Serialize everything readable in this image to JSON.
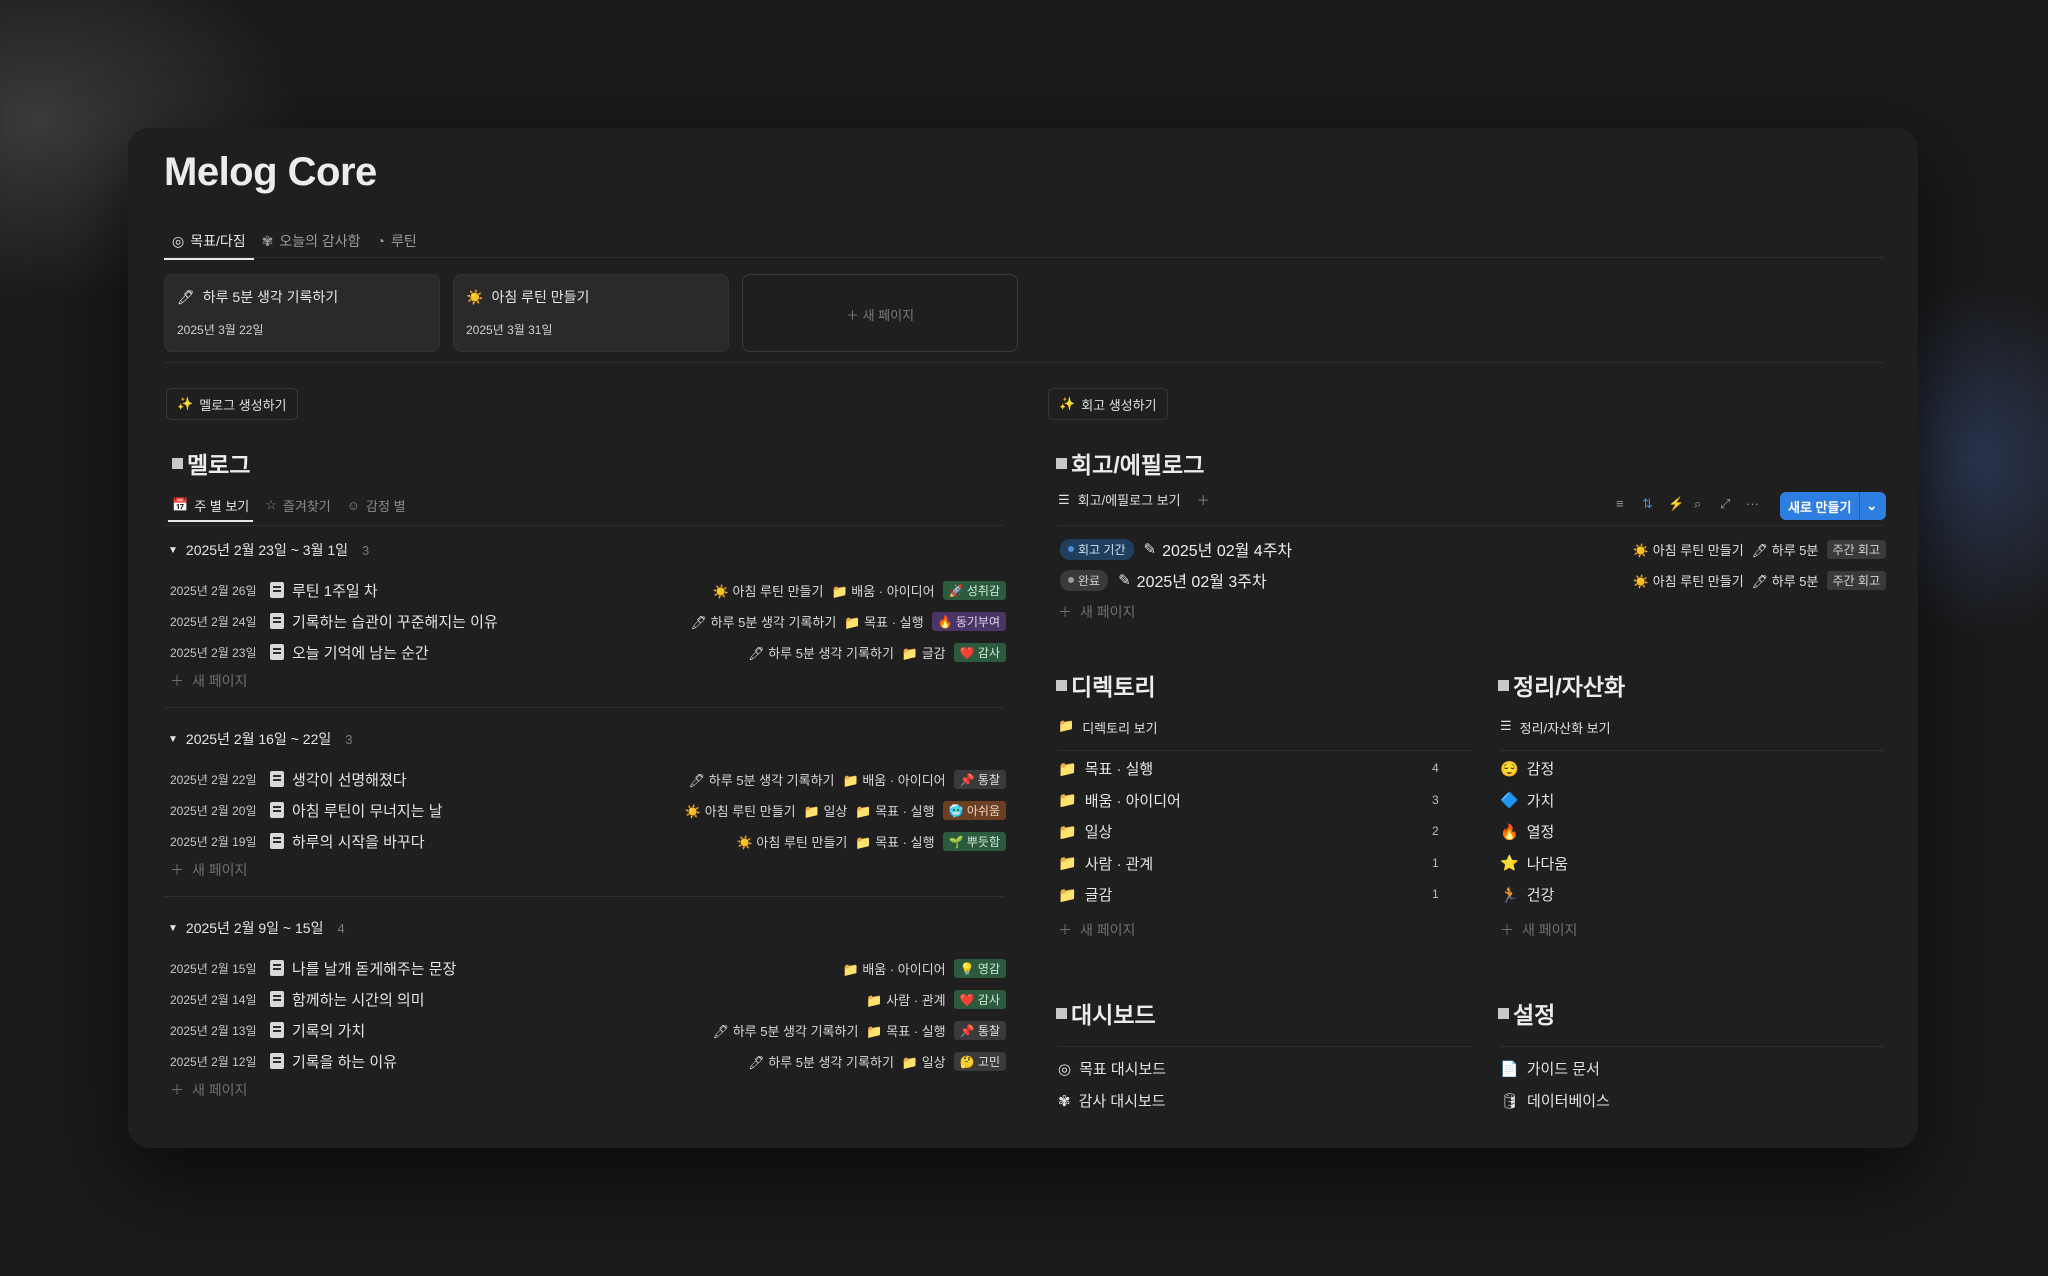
{
  "app": {
    "title": "Melog Core"
  },
  "tabs": [
    {
      "label": "목표/다짐",
      "icon": "target-icon"
    },
    {
      "label": "오늘의 감사함",
      "icon": "flower-icon"
    },
    {
      "label": "루틴",
      "icon": "routine-icon"
    }
  ],
  "goal_cards": [
    {
      "icon": "pencil-icon",
      "title": "하루 5분 생각 기록하기",
      "date": "2025년 3월 22일"
    },
    {
      "icon": "sun-icon",
      "title": "아침 루틴 만들기",
      "date": "2025년 3월 31일"
    }
  ],
  "new_page_label": "새 페이지",
  "melog": {
    "generate_label": "멜로그 생성하기",
    "title": "멜로그",
    "views": [
      "주 별 보기",
      "즐겨찾기",
      "감정 별"
    ],
    "groups": [
      {
        "label": "2025년 2월 23일 ~ 3월 1일",
        "count": "3",
        "rows": [
          {
            "date": "2025년 2월 26일",
            "title": "루틴 1주일 차",
            "goal": "☀️ 아침 루틴 만들기",
            "dirs": [
              "배움 · 아이디어"
            ],
            "tag": "🚀 성취감",
            "tag_bg": "#2c5a3e",
            "tag_fg": "#cfe8d6"
          },
          {
            "date": "2025년 2월 24일",
            "title": "기록하는 습관이 꾸준해지는 이유",
            "goal": "🖊 하루 5분 생각 기록하기",
            "dirs": [
              "목표 · 실행"
            ],
            "tag": "🔥 동기부여",
            "tag_bg": "#4a3666",
            "tag_fg": "#e0d2f0"
          },
          {
            "date": "2025년 2월 23일",
            "title": "오늘 기억에 남는 순간",
            "goal": "🖊 하루 5분 생각 기록하기",
            "dirs": [
              "글감"
            ],
            "tag": "❤️ 감사",
            "tag_bg": "#2c5a3e",
            "tag_fg": "#cfe8d6"
          }
        ]
      },
      {
        "label": "2025년 2월 16일 ~ 22일",
        "count": "3",
        "rows": [
          {
            "date": "2025년 2월 22일",
            "title": "생각이 선명해졌다",
            "goal": "🖊 하루 5분 생각 기록하기",
            "dirs": [
              "배움 · 아이디어"
            ],
            "tag": "📌 통찰",
            "tag_bg": "#3a3a3a",
            "tag_fg": "#e0e0e0"
          },
          {
            "date": "2025년 2월 20일",
            "title": "아침 루틴이 무너지는 날",
            "goal": "☀️ 아침 루틴 만들기",
            "dirs": [
              "일상",
              "목표 · 실행"
            ],
            "tag": "🥶 아쉬움",
            "tag_bg": "#6a3f22",
            "tag_fg": "#f0d8c4"
          },
          {
            "date": "2025년 2월 19일",
            "title": "하루의 시작을 바꾸다",
            "goal": "☀️ 아침 루틴 만들기",
            "dirs": [
              "목표 · 실행"
            ],
            "tag": "🌱 뿌듯함",
            "tag_bg": "#2c5a3e",
            "tag_fg": "#cfe8d6"
          }
        ]
      },
      {
        "label": "2025년 2월 9일 ~ 15일",
        "count": "4",
        "rows": [
          {
            "date": "2025년 2월 15일",
            "title": "나를 날개 돋게해주는 문장",
            "goal": "",
            "dirs": [
              "배움 · 아이디어"
            ],
            "tag": "💡 영감",
            "tag_bg": "#2c5a3e",
            "tag_fg": "#cfe8d6"
          },
          {
            "date": "2025년 2월 14일",
            "title": "함께하는 시간의 의미",
            "goal": "",
            "dirs": [
              "사람 · 관계"
            ],
            "tag": "❤️ 감사",
            "tag_bg": "#2c5a3e",
            "tag_fg": "#cfe8d6"
          },
          {
            "date": "2025년 2월 13일",
            "title": "기록의 가치",
            "goal": "🖊 하루 5분 생각 기록하기",
            "dirs": [
              "목표 · 실행"
            ],
            "tag": "📌 통찰",
            "tag_bg": "#3a3a3a",
            "tag_fg": "#e0e0e0"
          },
          {
            "date": "2025년 2월 12일",
            "title": "기록을 하는 이유",
            "goal": "🖊 하루 5분 생각 기록하기",
            "dirs": [
              "일상"
            ],
            "tag": "🤔 고민",
            "tag_bg": "#3a3a3a",
            "tag_fg": "#e0e0e0"
          }
        ]
      }
    ]
  },
  "retro": {
    "generate_label": "회고 생성하기",
    "title": "회고/에필로그",
    "view_label": "회고/에필로그 보기",
    "new_button": "새로 만들기",
    "rows": [
      {
        "status": "회고 기간",
        "status_bg": "#1f3f5e",
        "status_fg": "#cfe2f5",
        "dot": "#4a90d9",
        "title": "2025년 02월 4주차",
        "goal1": "☀️ 아침 루틴 만들기",
        "goal2": "🖊 하루 5분",
        "tag": "주간 회고"
      },
      {
        "status": "완료",
        "status_bg": "#3a3a3a",
        "status_fg": "#d0d0d0",
        "dot": "#9a9a9a",
        "title": "2025년 02월 3주차",
        "goal1": "☀️ 아침 루틴 만들기",
        "goal2": "🖊 하루 5분",
        "tag": "주간 회고"
      }
    ]
  },
  "directory": {
    "title": "디렉토리",
    "view_label": "디렉토리 보기",
    "items": [
      {
        "label": "목표 · 실행",
        "count": "4"
      },
      {
        "label": "배움 · 아이디어",
        "count": "3"
      },
      {
        "label": "일상",
        "count": "2"
      },
      {
        "label": "사람 · 관계",
        "count": "1"
      },
      {
        "label": "글감",
        "count": "1"
      }
    ]
  },
  "assets": {
    "title": "정리/자산화",
    "view_label": "정리/자산화 보기",
    "items": [
      {
        "emoji": "😌",
        "label": "감정"
      },
      {
        "emoji": "🔷",
        "label": "가치"
      },
      {
        "emoji": "🔥",
        "label": "열정"
      },
      {
        "emoji": "⭐",
        "label": "나다움"
      },
      {
        "emoji": "🏃",
        "label": "건강"
      }
    ]
  },
  "dashboard": {
    "title": "대시보드",
    "items": [
      {
        "icon": "target-icon",
        "label": "목표 대시보드"
      },
      {
        "icon": "flower-icon",
        "label": "감사 대시보드"
      }
    ]
  },
  "settings": {
    "title": "설정",
    "items": [
      {
        "icon": "document-icon",
        "label": "가이드 문서"
      },
      {
        "icon": "database-icon",
        "label": "데이터베이스"
      }
    ]
  }
}
